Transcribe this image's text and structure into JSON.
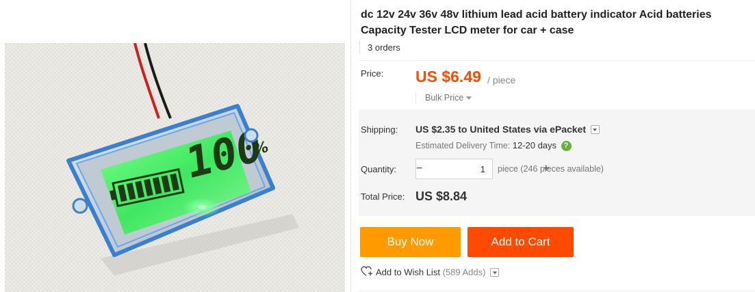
{
  "product": {
    "title": "dc 12v 24v 36v 48v lithium lead acid battery indicator Acid batteries Capacity Tester LCD meter for car + case",
    "orders": "3 orders",
    "image": {
      "display_number": "100",
      "display_unit": "%"
    }
  },
  "pricing": {
    "price_label": "Price:",
    "price_value": "US $6.49",
    "price_unit": "/ piece",
    "bulk_label": "Bulk Price"
  },
  "shipping": {
    "label": "Shipping:",
    "cost": "US $2.35",
    "to_word": "to",
    "destination": "United States via ePacket",
    "delivery_label": "Estimated Delivery Time:",
    "delivery_days": "12-20 days",
    "help_glyph": "?"
  },
  "quantity": {
    "label": "Quantity:",
    "value": "1",
    "decrement": "−",
    "increment": "+",
    "note": "piece (246 pieces available)"
  },
  "total": {
    "label": "Total Price:",
    "value": "US $8.84"
  },
  "actions": {
    "buy_now": "Buy Now",
    "add_to_cart": "Add to Cart",
    "wishlist": "Add to Wish List",
    "wishlist_count": "(589 Adds)"
  },
  "colors": {
    "price": "#ff4b00",
    "buy_now_bg": "#ff9a00",
    "add_to_cart_bg": "#ff4a00",
    "help_icon_bg": "#68b33b",
    "shipping_box_bg": "#f5f5f5"
  }
}
